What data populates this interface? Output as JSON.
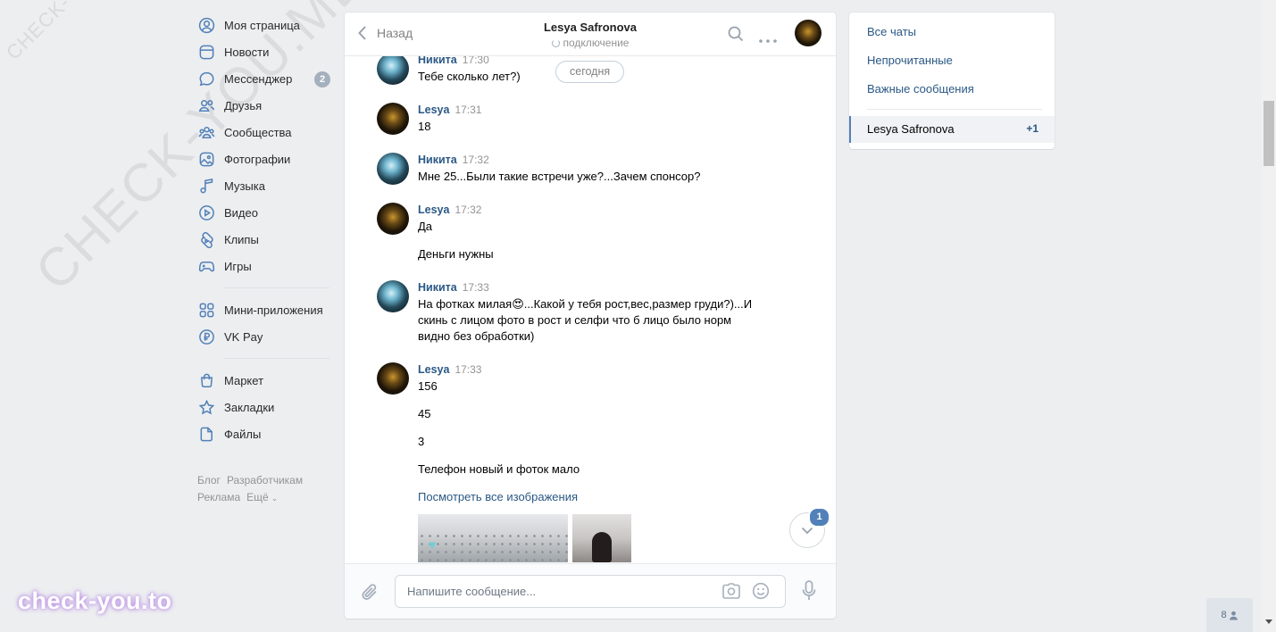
{
  "sidebar": {
    "items": [
      {
        "label": "Моя страница",
        "icon": "user-circle-icon"
      },
      {
        "label": "Новости",
        "icon": "news-icon"
      },
      {
        "label": "Мессенджер",
        "icon": "message-icon",
        "badge": "2"
      },
      {
        "label": "Друзья",
        "icon": "friends-icon"
      },
      {
        "label": "Сообщества",
        "icon": "communities-icon"
      },
      {
        "label": "Фотографии",
        "icon": "photos-icon"
      },
      {
        "label": "Музыка",
        "icon": "music-icon"
      },
      {
        "label": "Видео",
        "icon": "video-icon"
      },
      {
        "label": "Клипы",
        "icon": "clips-icon"
      },
      {
        "label": "Игры",
        "icon": "games-icon"
      },
      {
        "label": "Мини-приложения",
        "icon": "apps-icon"
      },
      {
        "label": "VK Pay",
        "icon": "vkpay-icon"
      },
      {
        "label": "Маркет",
        "icon": "market-icon"
      },
      {
        "label": "Закладки",
        "icon": "bookmark-icon"
      },
      {
        "label": "Файлы",
        "icon": "files-icon"
      }
    ],
    "footer": {
      "blog": "Блог",
      "developers": "Разработчикам",
      "ads": "Реклама",
      "more": "Ещё"
    }
  },
  "watermarks": {
    "small": "CHECK-YOU.ME",
    "large": "CHECK-YOU.ME",
    "brand": "check-you.to"
  },
  "chat": {
    "back_label": "Назад",
    "title": "Lesya Safronova",
    "status": "подключение",
    "date_pill": "сегодня",
    "messages": [
      {
        "author": "Никита",
        "time": "17:30",
        "lines": [
          "Тебе сколько лет?)"
        ]
      },
      {
        "author": "Lesya",
        "time": "17:31",
        "lines": [
          "18"
        ]
      },
      {
        "author": "Никита",
        "time": "17:32",
        "lines": [
          "Мне 25...Были такие встречи уже?...Зачем спонсор?"
        ]
      },
      {
        "author": "Lesya",
        "time": "17:32",
        "lines": [
          "Да",
          "Деньги нужны"
        ]
      },
      {
        "author": "Никита",
        "time": "17:33",
        "lines": [
          "На фотках милая😍...Какой у тебя рост,вес,размер груди?)...И скинь с лицом фото в рост и селфи что б лицо было норм видно без обработки)"
        ]
      },
      {
        "author": "Lesya",
        "time": "17:33",
        "lines": [
          "156",
          "45",
          "3",
          "Телефон новый и фоток мало"
        ],
        "view_all": "Посмотреть все изображения"
      }
    ],
    "scroll_badge": "1",
    "input_placeholder": "Напишите сообщение..."
  },
  "right_panel": {
    "filters": [
      "Все чаты",
      "Непрочитанные",
      "Важные сообщения"
    ],
    "active_chat": {
      "name": "Lesya Safronova",
      "count": "+1"
    }
  },
  "online_count": "8",
  "colors": {
    "accent": "#5181b8",
    "link": "#2a5885",
    "background": "#edeef0"
  }
}
